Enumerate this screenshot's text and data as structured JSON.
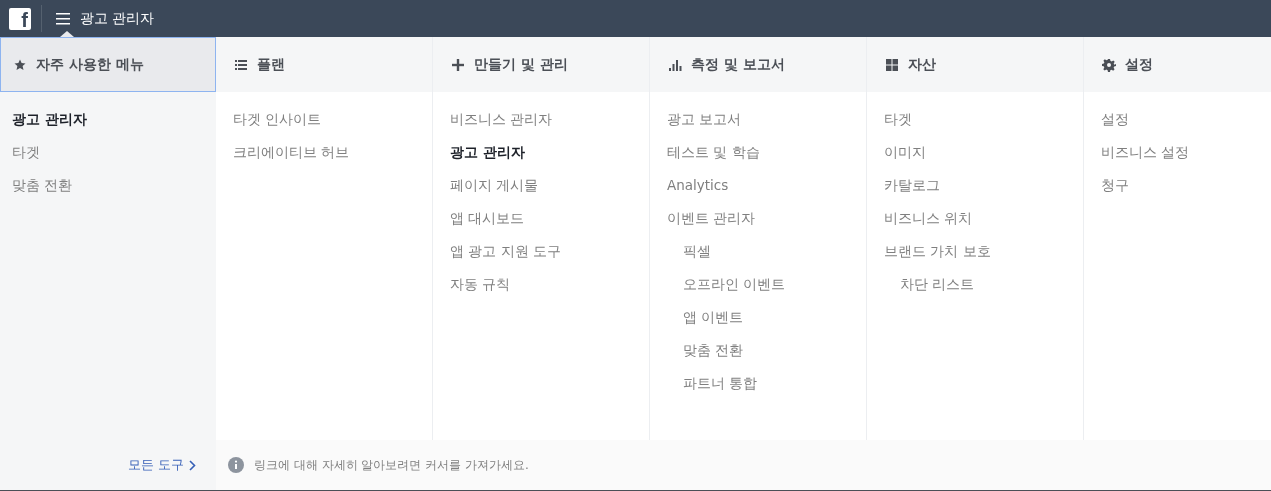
{
  "top_bar": {
    "logo": "f",
    "title": "광고 관리자"
  },
  "columns": [
    {
      "heading": "자주 사용한 메뉴",
      "selected": true,
      "items": [
        {
          "label": "광고 관리자",
          "selected": true
        },
        {
          "label": "타겟",
          "selected": false
        },
        {
          "label": "맞춤 전환",
          "selected": false
        }
      ]
    },
    {
      "heading": "플랜",
      "selected": false,
      "items": [
        {
          "label": "타겟 인사이트",
          "selected": false
        },
        {
          "label": "크리에이티브 허브",
          "selected": false
        }
      ]
    },
    {
      "heading": "만들기 및 관리",
      "selected": false,
      "items": [
        {
          "label": "비즈니스 관리자",
          "selected": false
        },
        {
          "label": "광고 관리자",
          "selected": true
        },
        {
          "label": "페이지 게시물",
          "selected": false
        },
        {
          "label": "앱 대시보드",
          "selected": false
        },
        {
          "label": "앱 광고 지원 도구",
          "selected": false
        },
        {
          "label": "자동 규칙",
          "selected": false
        }
      ]
    },
    {
      "heading": "측정 및 보고서",
      "selected": false,
      "items": [
        {
          "label": "광고 보고서",
          "selected": false
        },
        {
          "label": "테스트 및 학습",
          "selected": false
        },
        {
          "label": "Analytics",
          "selected": false
        },
        {
          "label": "이벤트 관리자",
          "selected": false,
          "children": [
            {
              "label": "픽셀",
              "selected": false
            },
            {
              "label": "오프라인 이벤트",
              "selected": false
            },
            {
              "label": "앱 이벤트",
              "selected": false
            },
            {
              "label": "맞춤 전환",
              "selected": false
            },
            {
              "label": "파트너 통합",
              "selected": false
            }
          ]
        }
      ]
    },
    {
      "heading": "자산",
      "selected": false,
      "items": [
        {
          "label": "타겟",
          "selected": false
        },
        {
          "label": "이미지",
          "selected": false
        },
        {
          "label": "카탈로그",
          "selected": false
        },
        {
          "label": "비즈니스 위치",
          "selected": false
        },
        {
          "label": "브랜드 가치 보호",
          "selected": false,
          "children": [
            {
              "label": "차단 리스트",
              "selected": false
            }
          ]
        }
      ]
    },
    {
      "heading": "설정",
      "selected": false,
      "items": [
        {
          "label": "설정",
          "selected": false
        },
        {
          "label": "비즈니스 설정",
          "selected": false
        },
        {
          "label": "청구",
          "selected": false
        }
      ]
    }
  ],
  "footer": {
    "all_tools": "모든 도구",
    "hint": "링크에 대해 자세히 알아보려면 커서를 가져가세요."
  }
}
